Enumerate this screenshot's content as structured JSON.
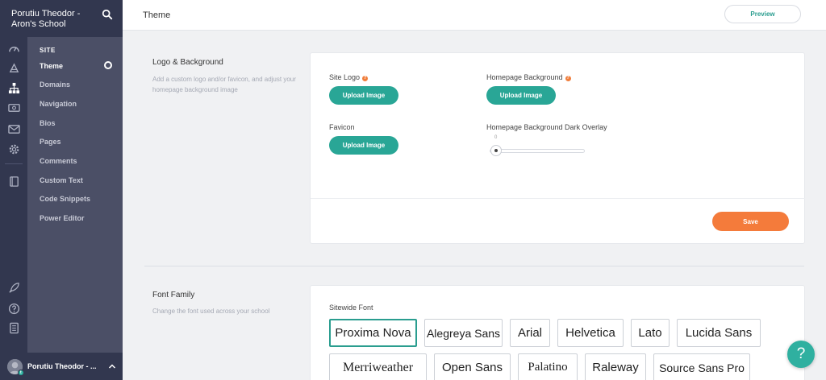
{
  "sidebar": {
    "school_title": "Porutiu Theodor - Aron's School",
    "section": "SITE",
    "items": [
      {
        "label": "Theme",
        "active": true
      },
      {
        "label": "Domains"
      },
      {
        "label": "Navigation"
      },
      {
        "label": "Bios"
      },
      {
        "label": "Pages"
      },
      {
        "label": "Comments"
      },
      {
        "label": "Custom Text"
      },
      {
        "label": "Code Snippets"
      },
      {
        "label": "Power Editor"
      }
    ],
    "rail_icons": [
      "dashboard-icon",
      "speedometer-icon",
      "sitemap-icon",
      "money-icon",
      "mail-icon",
      "gear-icon",
      "book-icon",
      "rocket-icon",
      "question-icon",
      "report-icon"
    ],
    "footer": {
      "name": "Porutiu Theodor - ...",
      "avatar_badge": "t"
    }
  },
  "header": {
    "title": "Theme",
    "preview_label": "Preview"
  },
  "logo_section": {
    "title": "Logo & Background",
    "description": "Add a custom logo and/or favicon, and adjust your homepage background image",
    "site_logo_label": "Site Logo",
    "homepage_bg_label": "Homepage Background",
    "favicon_label": "Favicon",
    "overlay_label": "Homepage Background Dark Overlay",
    "upload_label": "Upload Image",
    "overlay_value": "0",
    "save_label": "Save"
  },
  "font_section": {
    "title": "Font Family",
    "description": "Change the font used across your school",
    "sitewide_label": "Sitewide Font",
    "fonts": [
      "Proxima Nova",
      "Alegreya Sans",
      "Arial",
      "Helvetica",
      "Lato",
      "Lucida Sans",
      "Merriweather",
      "Open Sans",
      "Palatino",
      "Raleway",
      "Source Sans Pro"
    ],
    "selected": "Proxima Nova"
  },
  "help_fab": "?",
  "colors": {
    "teal": "#29a696",
    "orange": "#f47b3b",
    "sidebar_dark": "#32374f",
    "sidebar": "#4b4f66"
  }
}
